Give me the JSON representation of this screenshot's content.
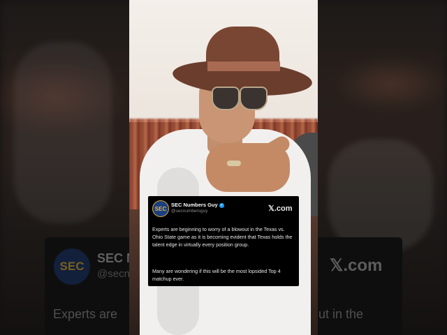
{
  "post": {
    "logo_text": "SEC",
    "author": "SEC Numbers Guy",
    "handle": "@secnumbersguy",
    "verified_icon": "verified-badge-icon",
    "source": "𝕏.com",
    "paragraph_1": "Experts are beginning to worry of a blowout in the Texas vs. Ohio State game as it is becoming evident that Texas holds the talent edge in virtually every position group.",
    "paragraph_2": "Many are wondering if this will be the most lopsided Top 4 matchup ever."
  },
  "background_blur": {
    "logo_text": "SEC",
    "name_fragment": "SEC Nu",
    "handle_fragment": "@secn",
    "source": "𝕏.com",
    "text_left": "Experts are",
    "text_right": "ut in the"
  },
  "colors": {
    "card_bg": "#000000",
    "verified": "#1d9bf0",
    "logo_blue": "#1c3f7f",
    "logo_gold": "#e6b43a"
  }
}
